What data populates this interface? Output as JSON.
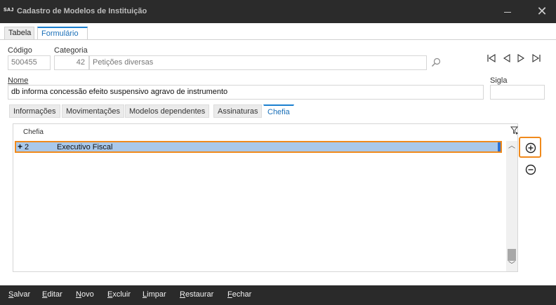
{
  "window": {
    "logo_text": "SAJ",
    "title": "Cadastro de Modelos de Instituição"
  },
  "main_tabs": [
    {
      "label": "Tabela",
      "active": false
    },
    {
      "label": "Formulário",
      "active": true
    }
  ],
  "form": {
    "codigo_label": "Código",
    "codigo_value": "500455",
    "categoria_label": "Categoria",
    "categoria_code": "42",
    "categoria_desc": "Petições diversas",
    "nome_label": "Nome",
    "nome_value": "db informa concessão efeito suspensivo agravo de instrumento",
    "sigla_label": "Sigla",
    "sigla_value": ""
  },
  "sub_tabs": [
    {
      "label": "Informações",
      "active": false
    },
    {
      "label": "Movimentações",
      "active": false
    },
    {
      "label": "Modelos dependentes",
      "active": false
    },
    {
      "label": "Assinaturas",
      "active": false
    },
    {
      "label": "Chefia",
      "active": true
    }
  ],
  "grid": {
    "column_header": "Chefia",
    "rows": [
      {
        "expander": "+",
        "code": "2",
        "name": "Executivo Fiscal",
        "selected": true
      }
    ]
  },
  "footer": {
    "buttons": [
      {
        "accel": "S",
        "rest": "alvar"
      },
      {
        "accel": "E",
        "rest": "ditar"
      },
      {
        "accel": "N",
        "rest": "ovo"
      },
      {
        "accel": "E",
        "rest": "xcluir"
      },
      {
        "accel": "L",
        "rest": "impar"
      },
      {
        "accel": "R",
        "rest": "estaurar"
      },
      {
        "accel": "F",
        "rest": "echar"
      }
    ]
  },
  "colors": {
    "accent": "#1a7fcf",
    "highlight": "#f08a1c",
    "selection": "#a9c8ea",
    "titlebar": "#2b2b2b"
  }
}
